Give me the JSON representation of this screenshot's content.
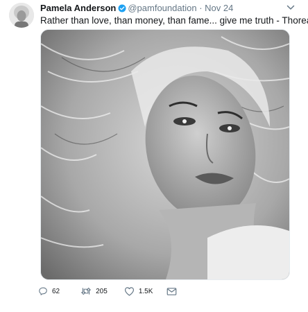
{
  "tweet": {
    "author_name": "Pamela Anderson",
    "handle": "@pamfoundation",
    "separator": "·",
    "timestamp": "Nov 24",
    "text": "Rather than love, than money, than fame... give me truth - Thoreau",
    "verified": true
  },
  "actions": {
    "replies": "62",
    "retweets": "205",
    "likes": "1.5K"
  },
  "icons": {
    "reply": "reply-icon",
    "retweet": "retweet-icon",
    "like": "heart-icon",
    "dm": "envelope-icon",
    "more": "chevron-down-icon",
    "verified": "verified-badge-icon"
  },
  "colors": {
    "verified": "#1da1f2",
    "secondary_text": "#657786",
    "icon": "#657786"
  }
}
